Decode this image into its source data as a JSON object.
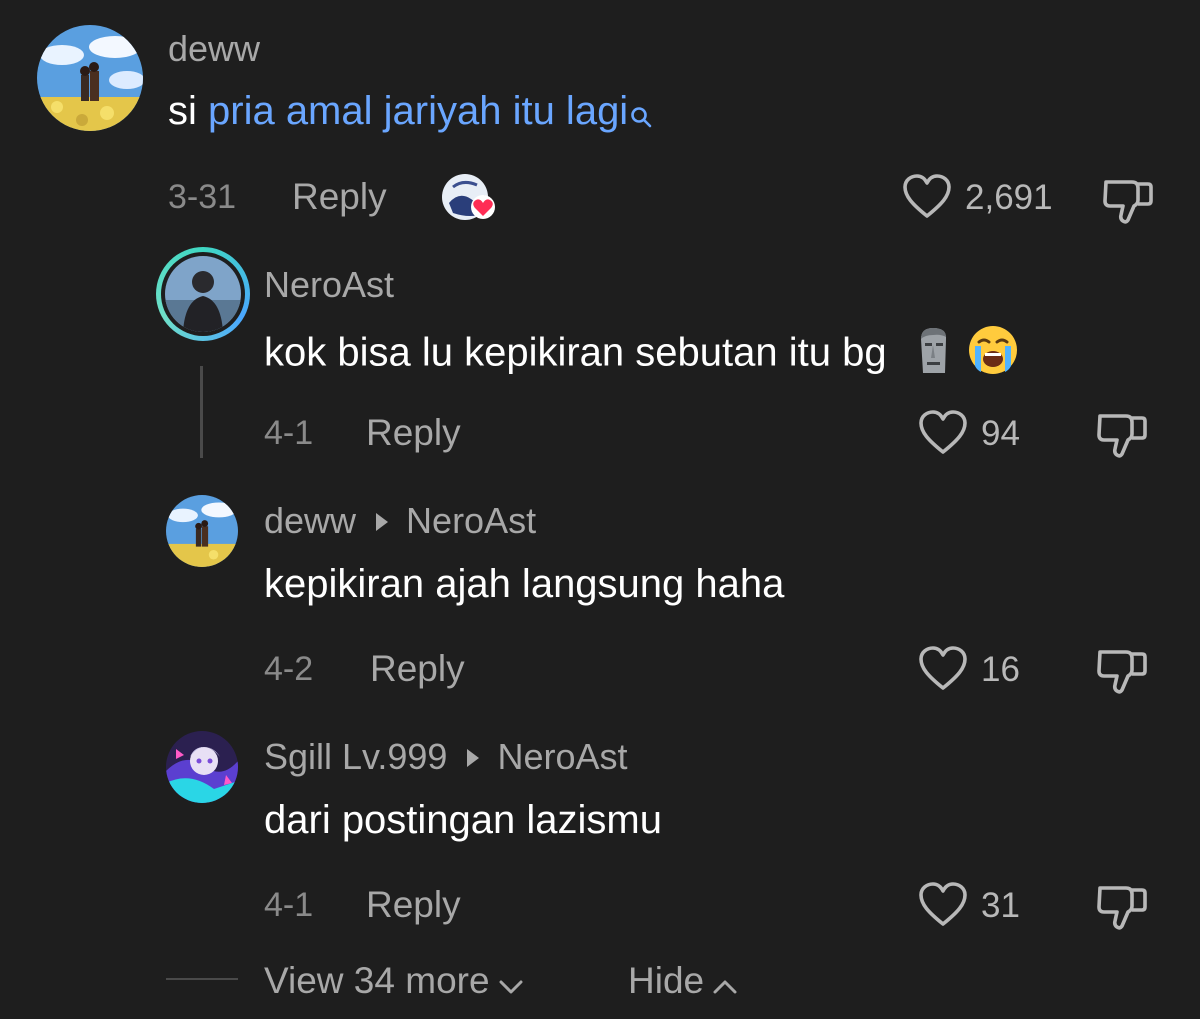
{
  "comment": {
    "username": "deww",
    "text_prefix": "si ",
    "text_link": "pria amal jariyah itu lagi",
    "date": "3-31",
    "reply_label": "Reply",
    "like_count": "2,691"
  },
  "replies": [
    {
      "username": "NeroAst",
      "text": "kok bisa lu kepikiran sebutan itu bg",
      "date": "4-1",
      "reply_label": "Reply",
      "like_count": "94"
    },
    {
      "username": "deww",
      "reply_to": "NeroAst",
      "text": "kepikiran ajah langsung haha",
      "date": "4-2",
      "reply_label": "Reply",
      "like_count": "16"
    },
    {
      "username": "Sgill Lv.999",
      "reply_to": "NeroAst",
      "text": "dari postingan lazismu",
      "date": "4-1",
      "reply_label": "Reply",
      "like_count": "31"
    }
  ],
  "footer": {
    "view_more": "View 34 more",
    "hide": "Hide"
  },
  "icons": {
    "like": "heart-outline-icon",
    "dislike": "thumbs-down-icon",
    "search": "search-icon",
    "creator_liked": "creator-heart-badge",
    "moai": "moai-emoji",
    "crying": "loudly-crying-emoji"
  },
  "colors": {
    "background": "#1e1e1e",
    "link": "#6aa6ff",
    "heart_badge": "#ff2d55",
    "avatar_ring": "#3fd7c2"
  }
}
